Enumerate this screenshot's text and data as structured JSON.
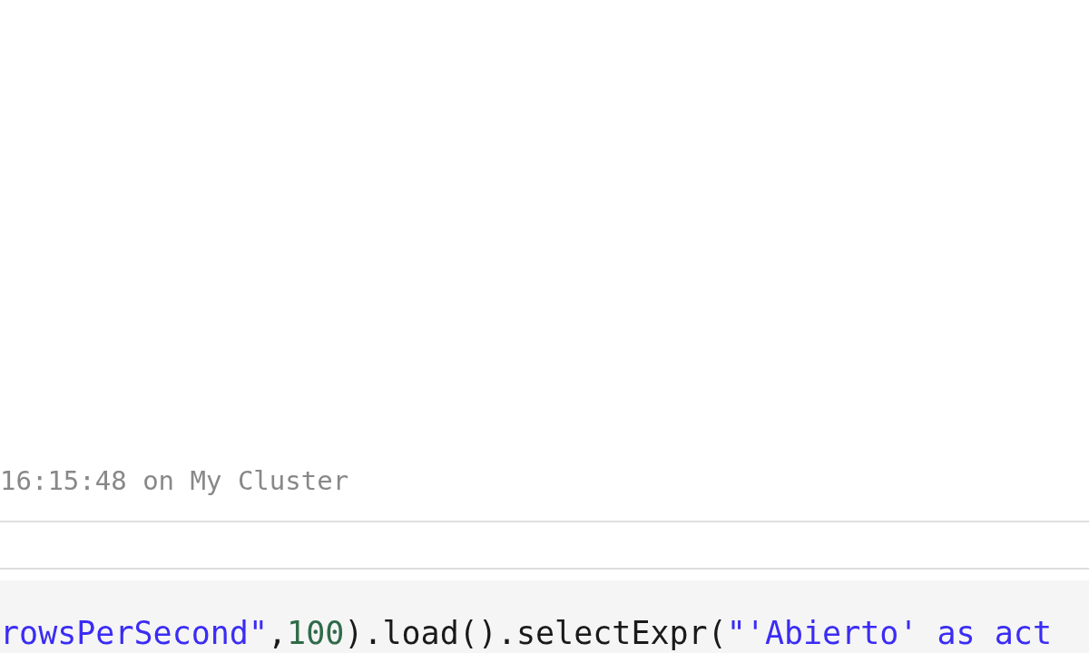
{
  "cell_status": {
    "text": "16:15:48 on My Cluster"
  },
  "code_cell": {
    "tokens": [
      {
        "kind": "string",
        "text": "rowsPerSecond\""
      },
      {
        "kind": "plain",
        "text": ","
      },
      {
        "kind": "number",
        "text": "100"
      },
      {
        "kind": "plain",
        "text": ").load().selectExpr("
      },
      {
        "kind": "string",
        "text": "\"'Abierto' as act"
      }
    ]
  }
}
